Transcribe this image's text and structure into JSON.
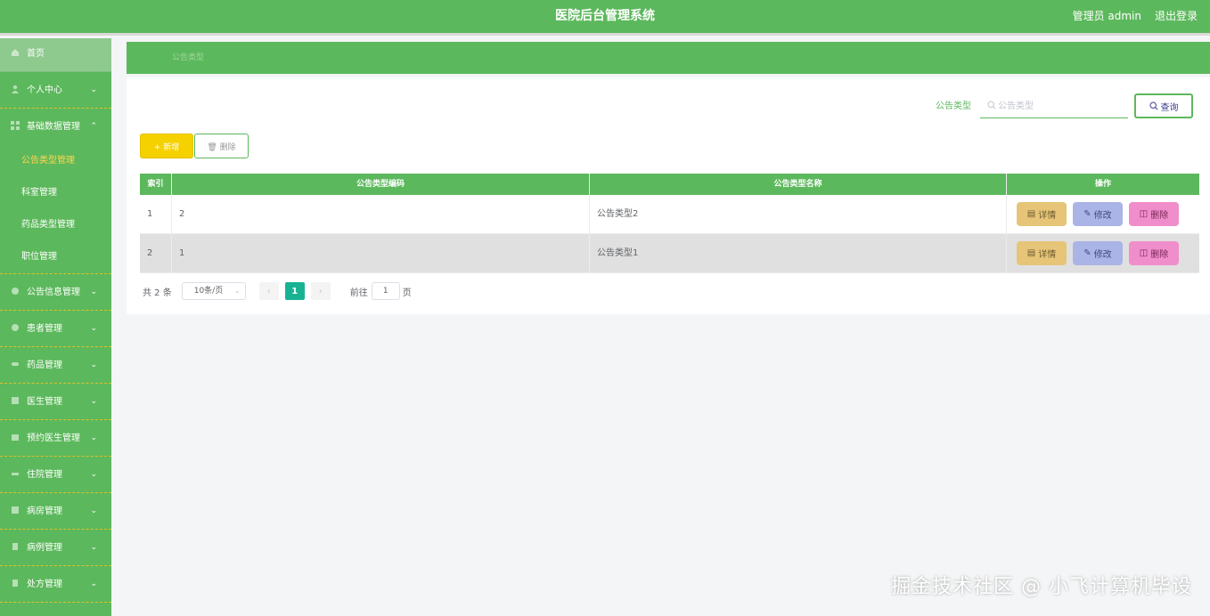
{
  "header": {
    "title": "医院后台管理系统",
    "user_label": "管理员 admin",
    "logout_label": "退出登录"
  },
  "sidebar": {
    "home": "首页",
    "items": [
      {
        "label": "个人中心"
      },
      {
        "label": "基础数据管理",
        "expanded": true,
        "children": [
          "公告类型管理",
          "科室管理",
          "药品类型管理",
          "职位管理"
        ]
      },
      {
        "label": "公告信息管理"
      },
      {
        "label": "患者管理"
      },
      {
        "label": "药品管理"
      },
      {
        "label": "医生管理"
      },
      {
        "label": "预约医生管理"
      },
      {
        "label": "住院管理"
      },
      {
        "label": "病房管理"
      },
      {
        "label": "病例管理"
      },
      {
        "label": "处方管理"
      }
    ],
    "active_child": "公告类型管理"
  },
  "breadcrumb": "公告类型",
  "search": {
    "label": "公告类型",
    "placeholder": "公告类型",
    "button": "查询"
  },
  "toolbar": {
    "add": "新增",
    "delete": "删除"
  },
  "table": {
    "headers": [
      "索引",
      "公告类型编码",
      "公告类型名称",
      "操作"
    ],
    "rows": [
      {
        "index": "1",
        "code": "2",
        "name": "公告类型2"
      },
      {
        "index": "2",
        "code": "1",
        "name": "公告类型1"
      }
    ],
    "actions": {
      "detail": "详情",
      "edit": "修改",
      "delete": "删除"
    }
  },
  "pagination": {
    "total": "共 2 条",
    "page_size": "10条/页",
    "current_page": "1",
    "goto_label": "前往",
    "goto_value": "1",
    "page_unit": "页"
  },
  "watermark": "掘金技术社区 @ 小飞计算机毕设",
  "colors": {
    "primary": "#5cb85c",
    "add": "#f5d100",
    "detail": "#e6c578",
    "edit": "#aab4e6",
    "delete": "#f08ecb",
    "page_active": "#19b394"
  }
}
